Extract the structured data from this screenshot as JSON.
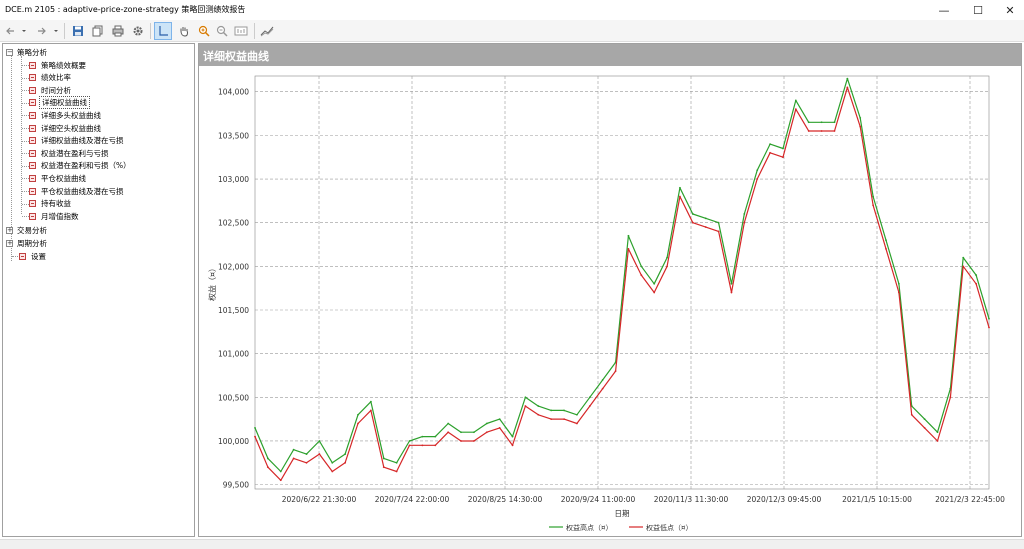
{
  "window": {
    "title": "DCE.m 2105 : adaptive-price-zone-strategy 策略回测绩效报告",
    "minimize": "—",
    "maximize": "☐",
    "close": "✕"
  },
  "toolbar": {
    "back_icon": "arrow-left-icon",
    "forward_icon": "arrow-right-icon",
    "save_icon": "save-icon",
    "copy_icon": "copy-icon",
    "print_icon": "print-icon",
    "settings_icon": "gear-icon",
    "crosshair_icon": "crosshair-icon",
    "pan_icon": "hand-icon",
    "zoom_in_icon": "zoom-in-icon",
    "zoom_out_icon": "zoom-out-icon",
    "fit_icon": "fit-icon",
    "chart_icon": "chart-icon"
  },
  "tree": {
    "strategy": {
      "label": "策略分析",
      "children": [
        "策略绩效概要",
        "绩效比率",
        "时间分析",
        "详细权益曲线",
        "详细多头权益曲线",
        "详细空头权益曲线",
        "详细权益曲线及潜在亏损",
        "权益潜在盈利与亏损",
        "权益潜在盈利和亏损（%）",
        "平仓权益曲线",
        "平仓权益曲线及潜在亏损",
        "持有收益",
        "月增值指数"
      ]
    },
    "trade": "交易分析",
    "period": "周期分析",
    "settings": "设置"
  },
  "panel": {
    "title": "详细权益曲线"
  },
  "chart_data": {
    "type": "line",
    "title": "详细权益曲线",
    "xlabel": "日期",
    "ylabel": "权益（¤）",
    "ylim": [
      99450,
      104180
    ],
    "yticks": [
      99500,
      100000,
      100500,
      101000,
      101500,
      102000,
      102500,
      103000,
      103500,
      104000
    ],
    "ytick_labels": [
      "99,500",
      "100,000",
      "100,500",
      "101,000",
      "101,500",
      "102,000",
      "102,500",
      "103,000",
      "103,500",
      "104,000"
    ],
    "xtick_labels": [
      "2020/6/22 21:30:00",
      "2020/7/24 22:00:00",
      "2020/8/25 14:30:00",
      "2020/9/24 11:00:00",
      "2020/11/3 11:30:00",
      "2020/12/3 09:45:00",
      "2021/1/5 10:15:00",
      "2021/2/3 22:45:00"
    ],
    "grid": true,
    "legend_position": "bottom-center",
    "series": [
      {
        "name": "权益高点（¤）",
        "color": "#2ca02c",
        "values": [
          100150,
          99800,
          99650,
          99900,
          99850,
          100000,
          99750,
          99850,
          100300,
          100450,
          99800,
          99750,
          100000,
          100050,
          100050,
          100200,
          100100,
          100100,
          100200,
          100250,
          100050,
          100500,
          100400,
          100350,
          100350,
          100300,
          100500,
          100700,
          100900,
          102350,
          102000,
          101800,
          102100,
          102900,
          102600,
          102550,
          102500,
          101800,
          102600,
          103100,
          103400,
          103350,
          103900,
          103650,
          103650,
          103650,
          104150,
          103700,
          102800,
          102300,
          101800,
          100400,
          100250,
          100100,
          100600,
          102100,
          101900,
          101400
        ]
      },
      {
        "name": "权益低点（¤）",
        "color": "#d62728",
        "values": [
          100050,
          99700,
          99550,
          99800,
          99750,
          99850,
          99650,
          99750,
          100200,
          100350,
          99700,
          99650,
          99950,
          99950,
          99950,
          100100,
          100000,
          100000,
          100100,
          100150,
          99950,
          100400,
          100300,
          100250,
          100250,
          100200,
          100400,
          100600,
          100800,
          102200,
          101900,
          101700,
          102000,
          102800,
          102500,
          102450,
          102400,
          101700,
          102500,
          103000,
          103300,
          103250,
          103800,
          103550,
          103550,
          103550,
          104050,
          103600,
          102700,
          102200,
          101700,
          100300,
          100150,
          100000,
          100500,
          102000,
          101800,
          101300
        ]
      }
    ]
  }
}
